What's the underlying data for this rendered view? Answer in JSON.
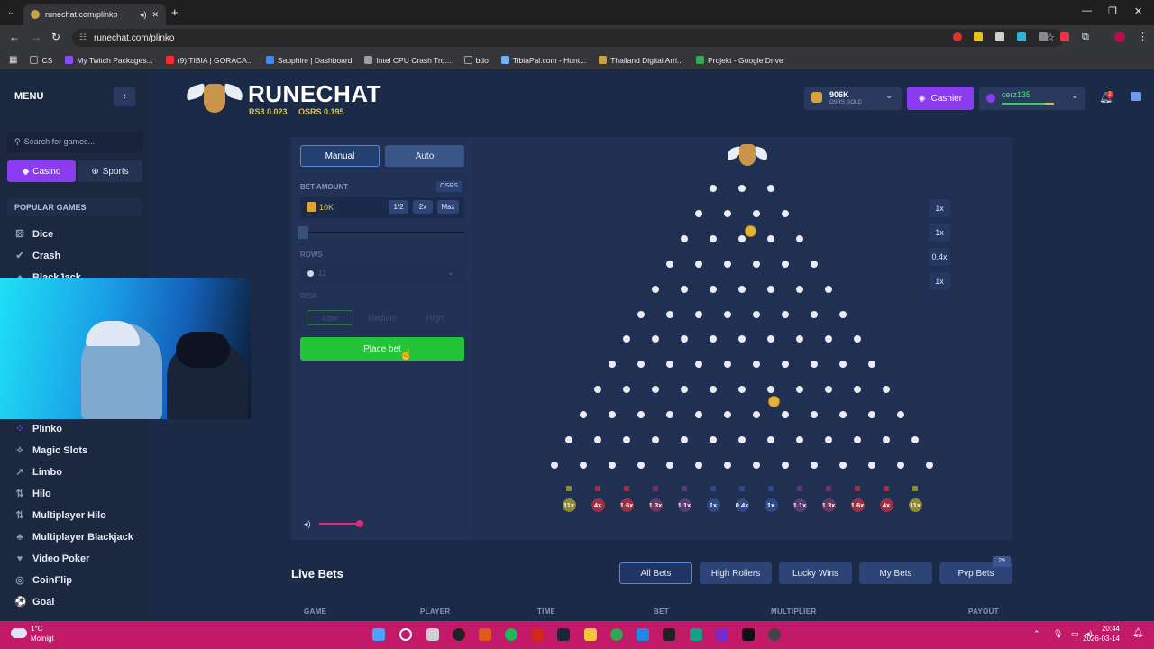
{
  "browser": {
    "tab_title": "runechat.com/plinko",
    "url": "runechat.com/plinko",
    "bookmarks": [
      {
        "label": "CS",
        "color": "#9aa0a6"
      },
      {
        "label": "My Twitch Packages...",
        "color": "#8a4dff"
      },
      {
        "label": "(9) TIBIA | GORACA...",
        "color": "#ff2a2a"
      },
      {
        "label": "Sapphire | Dashboard",
        "color": "#3d8bff"
      },
      {
        "label": "Intel CPU Crash Tro...",
        "color": "#9aa0a6"
      },
      {
        "label": "bdo",
        "color": "#9aa0a6"
      },
      {
        "label": "TibiaPal.com - Hunt...",
        "color": "#6fb3ff"
      },
      {
        "label": "Thailand Digital Arri...",
        "color": "#c7a24a"
      },
      {
        "label": "Projekt - Google Drive",
        "color": "#34a853"
      }
    ]
  },
  "sidebar": {
    "menu_label": "MENU",
    "search_placeholder": "Search for games...",
    "casino_label": "Casino",
    "sports_label": "Sports",
    "popular_heading": "POPULAR GAMES",
    "top_items": [
      "Dice",
      "Crash",
      "BlackJack"
    ],
    "items": [
      "Plinko",
      "Magic Slots",
      "Limbo",
      "Hilo",
      "Multiplayer Hilo",
      "Multiplayer Blackjack",
      "Video Poker",
      "CoinFlip",
      "Goal"
    ]
  },
  "header": {
    "logo": "RUNECHAT",
    "rs3_price": "RS3 0.023",
    "osrs_price": "OSRS 0.195",
    "balance": "906K",
    "balance_unit": "OSRS GOLD",
    "cashier_label": "Cashier",
    "username": "cerz135",
    "notification_count": "2"
  },
  "controls": {
    "manual_label": "Manual",
    "auto_label": "Auto",
    "bet_amount_label": "BET AMOUNT",
    "currency_badge": "OSRS",
    "bet_value": "10K",
    "half_label": "1/2",
    "double_label": "2x",
    "max_label": "Max",
    "rows_label": "ROWS",
    "rows_value": "12",
    "risk_label": "RISK",
    "risk_options": [
      "Low",
      "Medium",
      "High"
    ],
    "place_bet_label": "Place bet",
    "volume_level": 0.9
  },
  "board": {
    "recent_multipliers": [
      "1x",
      "1x",
      "0.4x",
      "1x"
    ],
    "buckets": [
      {
        "label": "11x",
        "color": "#8f8a2f"
      },
      {
        "label": "4x",
        "color": "#a0303f"
      },
      {
        "label": "1.6x",
        "color": "#a0303f"
      },
      {
        "label": "1.3x",
        "color": "#6e3460"
      },
      {
        "label": "1.1x",
        "color": "#5a3a78"
      },
      {
        "label": "1x",
        "color": "#2d4a86"
      },
      {
        "label": "0.4x",
        "color": "#2d4a86"
      },
      {
        "label": "1x",
        "color": "#2d4a86"
      },
      {
        "label": "1.1x",
        "color": "#5a3a78"
      },
      {
        "label": "1.3x",
        "color": "#6e3460"
      },
      {
        "label": "1.6x",
        "color": "#a0303f"
      },
      {
        "label": "4x",
        "color": "#a0303f"
      },
      {
        "label": "11x",
        "color": "#8f8a2f"
      }
    ]
  },
  "live_bets": {
    "title": "Live Bets",
    "tabs": [
      "All Bets",
      "High Rollers",
      "Lucky Wins",
      "My Bets",
      "Pvp Bets"
    ],
    "pvp_badge": "29",
    "columns": [
      "GAME",
      "PLAYER",
      "TIME",
      "BET",
      "MULTIPLIER",
      "PAYOUT"
    ]
  },
  "taskbar": {
    "temperature": "1°C",
    "weather": "Molnigt",
    "time": "20:44",
    "date": "2026-03-14"
  }
}
